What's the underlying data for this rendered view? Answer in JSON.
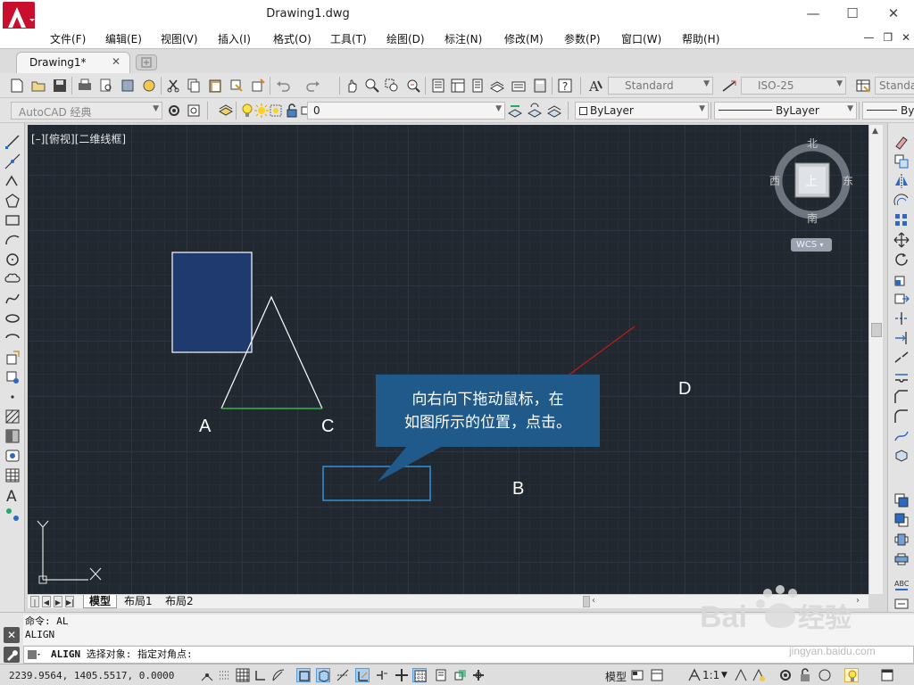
{
  "window": {
    "title": "Drawing1.dwg",
    "minimize": "—",
    "maximize": "☐",
    "close": "✕"
  },
  "menu": {
    "items": [
      "文件(F)",
      "编辑(E)",
      "视图(V)",
      "插入(I)",
      "格式(O)",
      "工具(T)",
      "绘图(D)",
      "标注(N)",
      "修改(M)",
      "参数(P)",
      "窗口(W)",
      "帮助(H)"
    ],
    "mdi_minimize": "—",
    "mdi_restore": "❐",
    "mdi_close": "✕"
  },
  "tabs": {
    "document": "Drawing1*",
    "close": "✕"
  },
  "toolbar1": {
    "text_style": "Standard",
    "dim_style": "ISO-25",
    "table_style": "Standa"
  },
  "toolbar2": {
    "workspace": "AutoCAD 经典",
    "layer": "0",
    "color": "ByLayer",
    "linetype": "ByLayer",
    "lineweight": "By"
  },
  "canvas": {
    "viewport_label": "[–][俯视][二维线框]",
    "point_labels": [
      "A",
      "C",
      "D",
      "B"
    ],
    "callout": "向右向下拖动鼠标，在\n如图所示的位置，点击。",
    "ucs_x": "X",
    "ucs_y": "Y"
  },
  "viewcube": {
    "north": "北",
    "south": "南",
    "east": "东",
    "west": "西",
    "top": "上",
    "wcs": "WCS"
  },
  "layout_tabs": [
    "模型",
    "布局1",
    "布局2"
  ],
  "command": {
    "history": [
      "命令: AL",
      "ALIGN"
    ],
    "current_cmd": "ALIGN",
    "prompt": "选择对象: 指定对角点:",
    "close": "✕"
  },
  "status": {
    "coordinates": "2239.9564, 1405.5517, 0.0000",
    "model": "模型",
    "annotation_scale": "1:1"
  },
  "watermark": {
    "brand": "Baidu经验",
    "url": "jingyan.baidu.com"
  },
  "colors": {
    "canvas_bg": "#212830",
    "rectangle_fill": "#1e3a6e",
    "triangle_base": "#37b24d",
    "red_line": "#c41a1a",
    "callout_bg": "#1f5a8a",
    "selection_box": "#2e8bd1",
    "app_button": "#c8102e"
  }
}
